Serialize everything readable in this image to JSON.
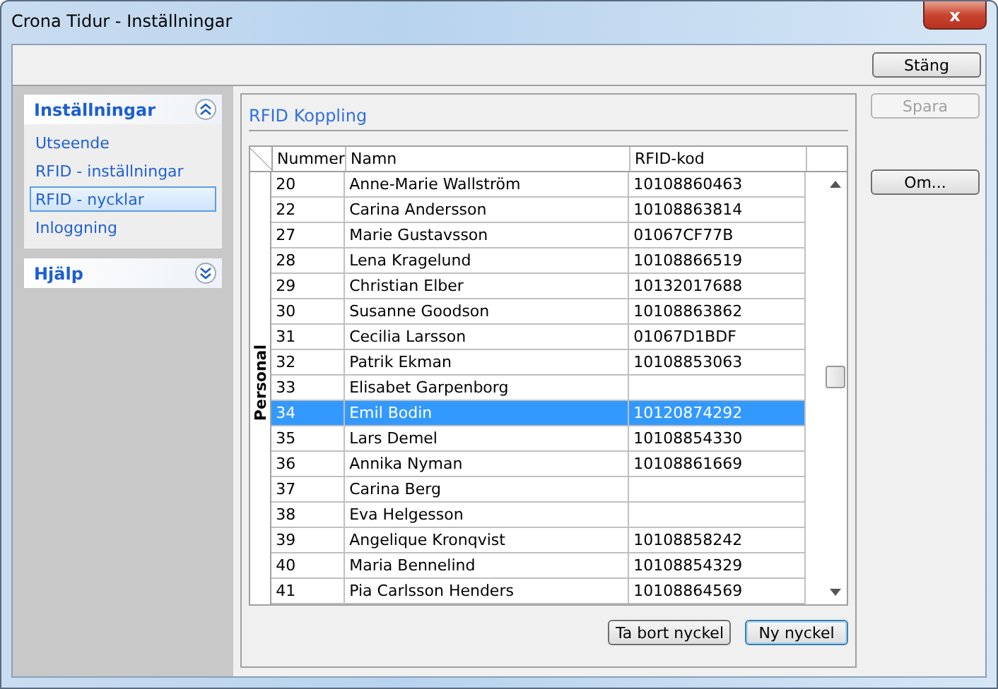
{
  "window": {
    "title": "Crona Tidur - Inställningar",
    "close_label": "x"
  },
  "toolbar": {
    "buttons": [
      {
        "label": "Stäng",
        "disabled": false
      }
    ]
  },
  "sidebar": {
    "sections": [
      {
        "title": "Inställningar",
        "expanded": true,
        "items": [
          {
            "label": "Utseende",
            "selected": false
          },
          {
            "label": "RFID - inställningar",
            "selected": false
          },
          {
            "label": "RFID - nycklar",
            "selected": true
          },
          {
            "label": "Inloggning",
            "selected": false
          }
        ]
      },
      {
        "title": "Hjälp",
        "expanded": false
      }
    ]
  },
  "panel": {
    "title": "RFID Koppling",
    "table": {
      "group": "Personal",
      "columns": [
        "Nummer",
        "Namn",
        "RFID-kod"
      ],
      "rows": [
        {
          "cells": [
            "20",
            "Anne-Marie Wallström",
            "10108860463"
          ],
          "selected": false
        },
        {
          "cells": [
            "22",
            "Carina Andersson",
            "10108863814"
          ],
          "selected": false
        },
        {
          "cells": [
            "27",
            "Marie Gustavsson",
            "01067CF77B"
          ],
          "selected": false
        },
        {
          "cells": [
            "28",
            "Lena Kragelund",
            "10108866519"
          ],
          "selected": false
        },
        {
          "cells": [
            "29",
            "Christian Elber",
            "10132017688"
          ],
          "selected": false
        },
        {
          "cells": [
            "30",
            "Susanne Goodson",
            "10108863862"
          ],
          "selected": false
        },
        {
          "cells": [
            "31",
            "Cecilia Larsson",
            "01067D1BDF"
          ],
          "selected": false
        },
        {
          "cells": [
            "32",
            "Patrik Ekman",
            "10108853063"
          ],
          "selected": false
        },
        {
          "cells": [
            "33",
            "Elisabet Garpenborg",
            ""
          ],
          "selected": false
        },
        {
          "cells": [
            "34",
            "Emil Bodin",
            "10120874292"
          ],
          "selected": true
        },
        {
          "cells": [
            "35",
            "Lars Demel",
            "10108854330"
          ],
          "selected": false
        },
        {
          "cells": [
            "36",
            "Annika Nyman",
            "10108861669"
          ],
          "selected": false
        },
        {
          "cells": [
            "37",
            "Carina Berg",
            ""
          ],
          "selected": false
        },
        {
          "cells": [
            "38",
            "Eva Helgesson",
            ""
          ],
          "selected": false
        },
        {
          "cells": [
            "39",
            "Angelique Kronqvist",
            "10108858242"
          ],
          "selected": false
        },
        {
          "cells": [
            "40",
            "Maria Bennelind",
            "10108854329"
          ],
          "selected": false
        },
        {
          "cells": [
            "41",
            "Pia Carlsson Henders",
            "10108864569"
          ],
          "selected": false
        }
      ]
    },
    "buttons": [
      {
        "label": "Ta bort nyckel",
        "default": false
      },
      {
        "label": "Ny nyckel",
        "default": true
      }
    ]
  },
  "side_buttons": [
    {
      "label": "Spara",
      "disabled": true
    },
    {
      "label": "Om...",
      "disabled": false
    }
  ]
}
